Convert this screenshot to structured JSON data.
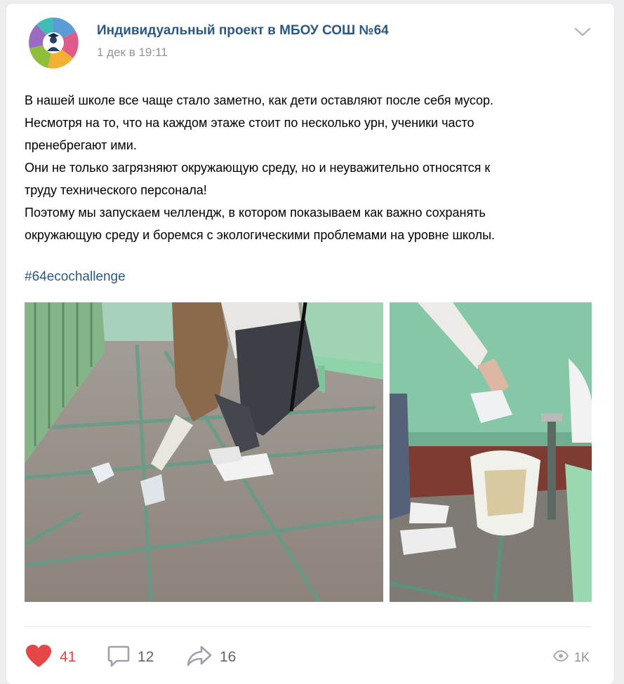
{
  "post": {
    "author": "Индивидуальный проект в МБОУ СОШ №64",
    "date": "1 дек в 19:11",
    "text": [
      "В нашей школе все чаще стало заметно, как дети оставляют после себя мусор.",
      "Несмотря на то, что на каждом этаже стоит по несколько урн, ученики часто",
      "пренебрегают ими.",
      "Они не только загрязняют окружающую среду, но и неуважительно относятся к",
      "труду технического персонала!",
      "Поэтому мы запускаем челлендж, в котором показываем как важно сохранять",
      "окружающую среду и боремся с экологическими проблемами на уровне школы."
    ],
    "hashtag": "#64ecochallenge"
  },
  "actions": {
    "likes": "41",
    "comments": "12",
    "shares": "16",
    "views": "1K"
  },
  "colors": {
    "link": "#2a5885",
    "like": "#e64646",
    "muted": "#939393",
    "icon": "#99a2ad"
  },
  "icons": {
    "menu": "chevron-down-icon",
    "like": "heart-icon",
    "comment": "comment-icon",
    "share": "share-arrow-icon",
    "views": "eye-icon"
  }
}
